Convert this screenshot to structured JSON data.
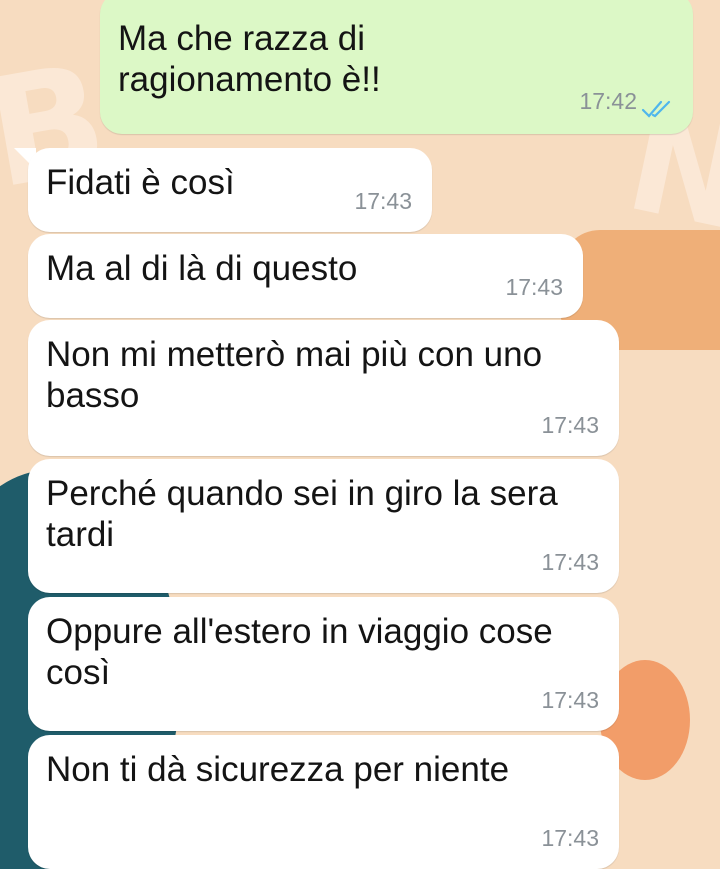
{
  "chat": {
    "messages": [
      {
        "direction": "outgoing",
        "text": "Ma che razza di ragionamento è!!",
        "time": "17:42",
        "status": "read"
      },
      {
        "direction": "incoming",
        "text": "Fidati è così",
        "time": "17:43"
      },
      {
        "direction": "incoming",
        "text": "Ma al di là di questo",
        "time": "17:43"
      },
      {
        "direction": "incoming",
        "text": "Non mi metterò mai più con uno basso",
        "time": "17:43"
      },
      {
        "direction": "incoming",
        "text": "Perché quando sei in giro la sera tardi",
        "time": "17:43"
      },
      {
        "direction": "incoming",
        "text": "Oppure all'estero in viaggio cose così",
        "time": "17:43"
      },
      {
        "direction": "incoming",
        "text": "Non ti dà sicurezza per niente",
        "time": "17:43"
      }
    ]
  },
  "colors": {
    "outgoing_bubble": "#dcf8c6",
    "incoming_bubble": "#ffffff",
    "read_ticks": "#4fb6ec",
    "timestamp": "#8a9197",
    "wallpaper": "#f7dcc0"
  },
  "icons": {
    "read_receipt": "double-check-icon"
  }
}
